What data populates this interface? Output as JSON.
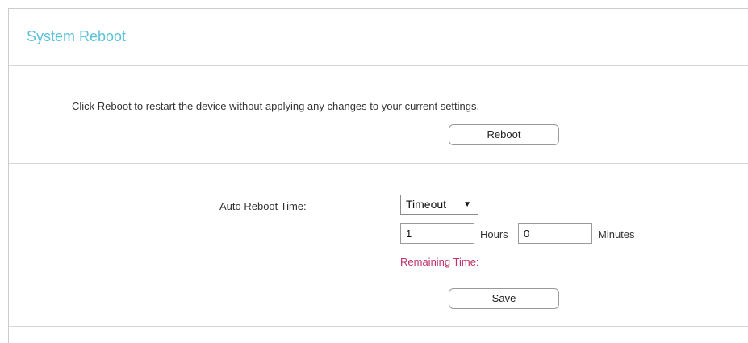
{
  "page": {
    "title": "System Reboot"
  },
  "reboot_section": {
    "description": "Click Reboot to restart the device without applying any changes to your current settings.",
    "reboot_label": "Reboot"
  },
  "auto_reboot": {
    "label": "Auto Reboot Time:",
    "mode_selected": "Timeout",
    "hours_value": "1",
    "hours_unit": "Hours",
    "minutes_value": "0",
    "minutes_unit": "Minutes",
    "remaining_label": "Remaining Time:",
    "save_label": "Save"
  },
  "colors": {
    "title": "#5bc2d6",
    "remaining_text": "#c0306b",
    "divider": "#d6d6d6"
  },
  "icons": {
    "select_arrow": "dropdown-arrow-icon"
  }
}
